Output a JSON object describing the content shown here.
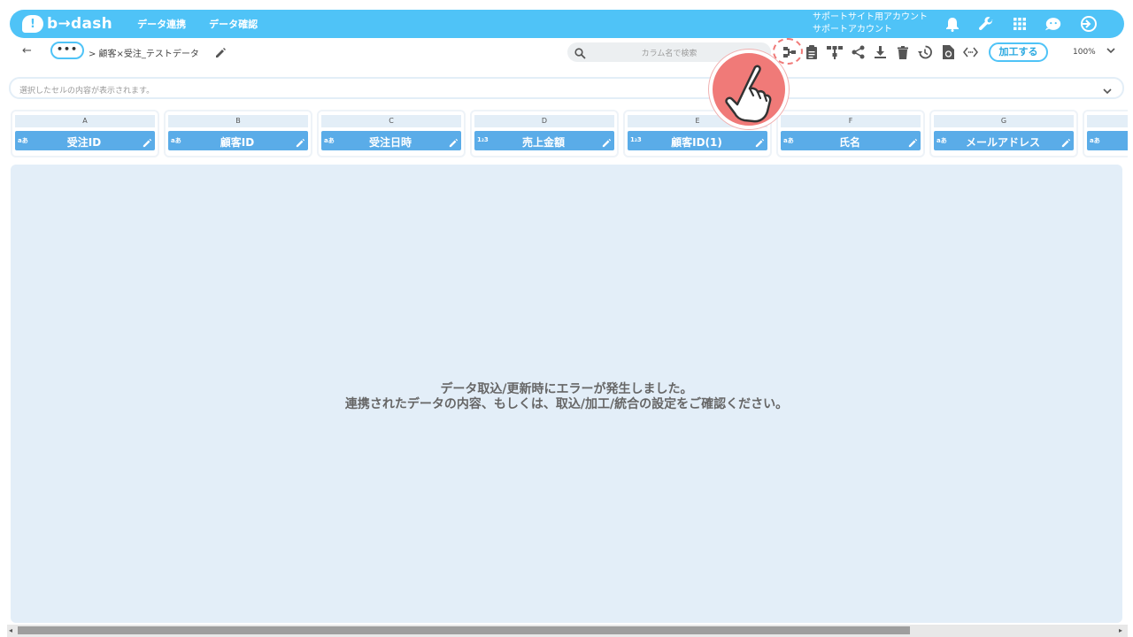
{
  "app": {
    "logo_text": "b→dash",
    "nav_links": [
      "データ連携",
      "データ確認"
    ],
    "account_line1": "サポートサイト用アカウント",
    "account_line2": "サポートアカウント"
  },
  "toolbar": {
    "back": "←",
    "more": "•••",
    "breadcrumb": "> 顧客×受注_テストデータ",
    "search_placeholder": "カラム名で検索",
    "process_button": "加工する",
    "zoom": "100%"
  },
  "cellbar": {
    "placeholder": "選択したセルの内容が表示されます。"
  },
  "columns": [
    {
      "letter": "A",
      "type": "aあ",
      "name": "受注ID"
    },
    {
      "letter": "B",
      "type": "aあ",
      "name": "顧客ID"
    },
    {
      "letter": "C",
      "type": "aあ",
      "name": "受注日時"
    },
    {
      "letter": "D",
      "type": "1₂3",
      "name": "売上金額"
    },
    {
      "letter": "E",
      "type": "1₂3",
      "name": "顧客ID(1)"
    },
    {
      "letter": "F",
      "type": "aあ",
      "name": "氏名"
    },
    {
      "letter": "G",
      "type": "aあ",
      "name": "メールアドレス"
    },
    {
      "letter": "",
      "type": "aあ",
      "name": ""
    }
  ],
  "error": {
    "line1": "データ取込/更新時にエラーが発生しました。",
    "line2": "連携されたデータの内容、もしくは、取込/加工/統合の設定をご確認ください。"
  },
  "colors": {
    "brand": "#4fc3f7",
    "column_header": "#5aace8",
    "highlight": "#f07a78"
  }
}
